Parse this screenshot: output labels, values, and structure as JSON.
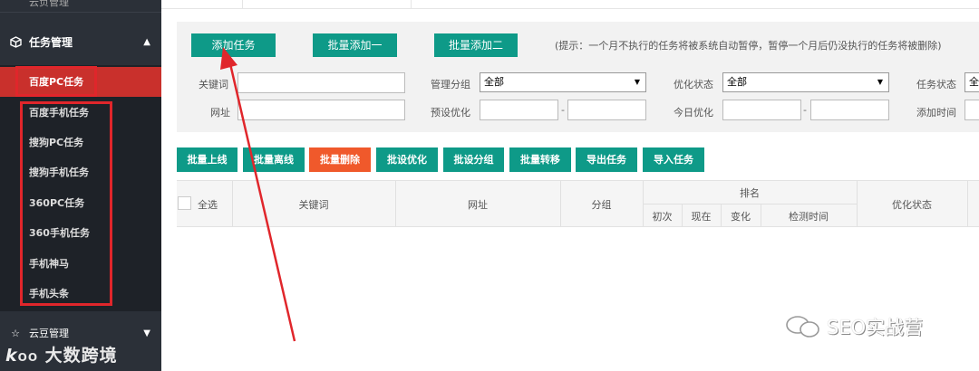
{
  "sidebar": {
    "top_partial_label": "云负管理",
    "section_title": "任务管理",
    "items": [
      {
        "label": "百度PC任务",
        "active": true
      },
      {
        "label": "百度手机任务"
      },
      {
        "label": "搜狗PC任务"
      },
      {
        "label": "搜狗手机任务"
      },
      {
        "label": "360PC任务"
      },
      {
        "label": "360手机任务"
      },
      {
        "label": "手机神马"
      },
      {
        "label": "手机头条"
      }
    ],
    "cloud_section": "云豆管理",
    "logo_text": "大数跨境"
  },
  "toolbar": {
    "add_task": "添加任务",
    "batch_add_1": "批量添加一",
    "batch_add_2": "批量添加二",
    "tip": "(提示：一个月不执行的任务将被系统自动暂停，暂停一个月后仍没执行的任务将被删除)"
  },
  "filters": {
    "keyword_label": "关键词",
    "group_label": "管理分组",
    "group_value": "全部",
    "opt_status_label": "优化状态",
    "opt_status_value": "全部",
    "task_status_label": "任务状态",
    "task_status_value": "全",
    "url_label": "网址",
    "preset_opt_label": "预设优化",
    "today_opt_label": "今日优化",
    "add_time_label": "添加时间",
    "range_sep": "-"
  },
  "actions": [
    {
      "label": "批量上线",
      "color": "#0e9a88"
    },
    {
      "label": "批量离线",
      "color": "#0e9a88"
    },
    {
      "label": "批量删除",
      "color": "#f0592b"
    },
    {
      "label": "批设优化",
      "color": "#0e9a88"
    },
    {
      "label": "批设分组",
      "color": "#0e9a88"
    },
    {
      "label": "批量转移",
      "color": "#0e9a88"
    },
    {
      "label": "导出任务",
      "color": "#0e9a88"
    },
    {
      "label": "导入任务",
      "color": "#0e9a88"
    }
  ],
  "table": {
    "select_all": "全选",
    "keyword": "关键词",
    "url": "网址",
    "group": "分组",
    "rank": "排名",
    "rank_first": "初次",
    "rank_now": "现在",
    "rank_change": "变化",
    "check_time": "检测时间",
    "opt_status": "优化状态"
  },
  "watermark": "SEO实战营",
  "colors": {
    "sidebar_bg": "#2b3038",
    "active_item": "#c9302c",
    "accent_green": "#0e9a88",
    "danger_orange": "#f0592b",
    "annotation_red": "#e0262b"
  }
}
